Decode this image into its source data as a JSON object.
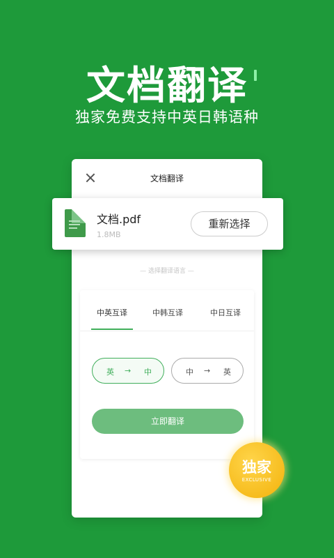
{
  "hero": {
    "title": "文档翻译",
    "subtitle": "独家免费支持中英日韩语种"
  },
  "card": {
    "title": "文档翻译"
  },
  "file": {
    "name": "文档.pdf",
    "size": "1.8MB",
    "reselect_label": "重新选择",
    "icon": "spreadsheet-file-icon"
  },
  "language": {
    "section_label": "— 选择翻译语言 —",
    "tabs": [
      {
        "label": "中英互译",
        "active": true
      },
      {
        "label": "中韩互译",
        "active": false
      },
      {
        "label": "中日互译",
        "active": false
      }
    ],
    "directions": [
      {
        "from": "英",
        "to": "中",
        "selected": true
      },
      {
        "from": "中",
        "to": "英",
        "selected": false
      }
    ],
    "arrow": "→"
  },
  "translate_button": {
    "label": "立即翻译"
  },
  "badge": {
    "main": "独家",
    "sub": "EXCLUSIVE"
  },
  "colors": {
    "background": "#1e9a3a",
    "accent": "#3fae5a",
    "button": "#6dbd7e",
    "badge": "#f3b20b"
  }
}
